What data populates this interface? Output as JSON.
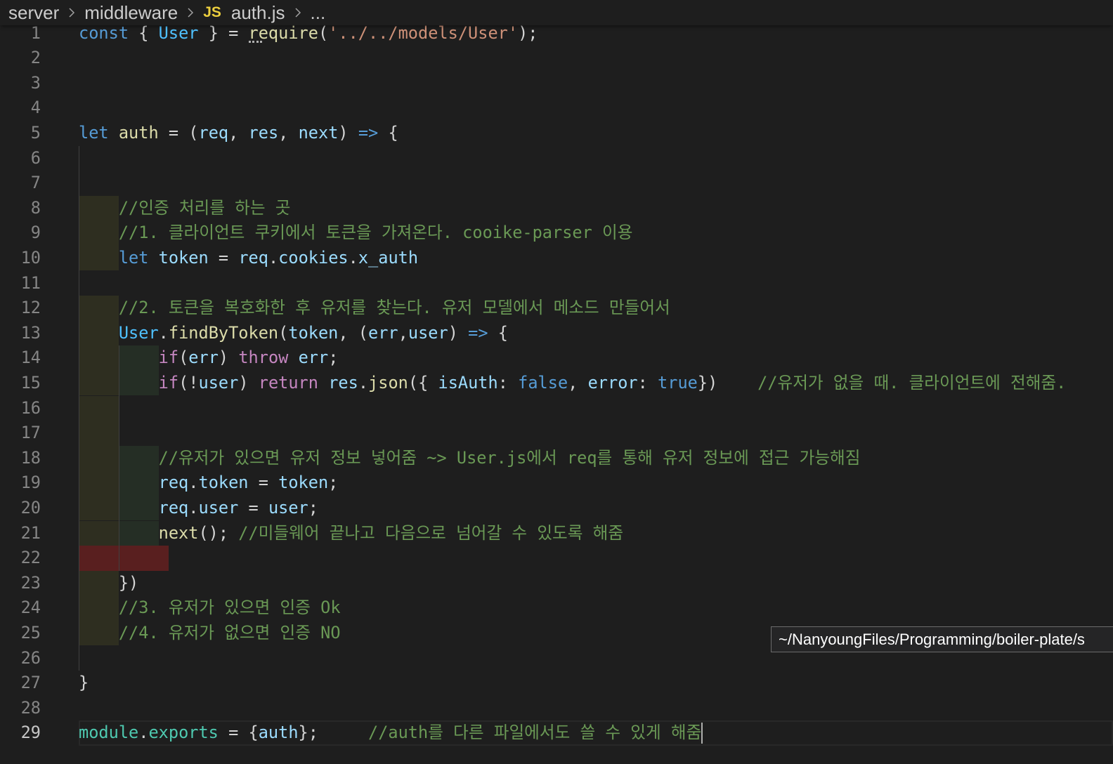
{
  "breadcrumb": {
    "folder_1": "server",
    "folder_2": "middleware",
    "file_icon_label": "JS",
    "file": "auth.js",
    "symbol": "...",
    "separator_icon": "chevron-right-icon"
  },
  "tooltip": {
    "text": "~/NanyoungFiles/Programming/boiler-plate/s"
  },
  "colors": {
    "background": "#1e1e1e",
    "js_icon": "#eccf3e",
    "syntax": {
      "kw": "#569cd6",
      "ctl": "#c586c0",
      "fn": "#dcdcaa",
      "fnh": "#dcdcaa",
      "var": "#9cdcfe",
      "cst": "#4fc1ff",
      "str": "#ce9178",
      "cmt": "#6a9955",
      "p": "#d4d4d4",
      "ty": "#4ec9b0"
    },
    "indent_levels": [
      "#ffff4012",
      "#7fff7f12",
      "#ff7fff12",
      "#4fecec12"
    ],
    "indent_error": "#80202099"
  },
  "editor": {
    "current_line": 29,
    "lines": [
      {
        "n": 1,
        "tokens": [
          {
            "kw": "const"
          },
          {
            "p": " { "
          },
          {
            "cst": "User"
          },
          {
            "p": " } = "
          },
          {
            "fnh": "require"
          },
          {
            "p": "("
          },
          {
            "str": "'../../models/User'"
          },
          {
            "p": ");"
          }
        ]
      },
      {
        "n": 2,
        "tokens": []
      },
      {
        "n": 3,
        "tokens": []
      },
      {
        "n": 4,
        "tokens": []
      },
      {
        "n": 5,
        "tokens": [
          {
            "kw": "let"
          },
          {
            "p": " "
          },
          {
            "fn": "auth"
          },
          {
            "p": " = ("
          },
          {
            "var": "req"
          },
          {
            "p": ", "
          },
          {
            "var": "res"
          },
          {
            "p": ", "
          },
          {
            "var": "next"
          },
          {
            "p": ") "
          },
          {
            "kw": "=>"
          },
          {
            "p": " {"
          }
        ]
      },
      {
        "n": 6,
        "tokens": []
      },
      {
        "n": 7,
        "tokens": []
      },
      {
        "n": 8,
        "tokens": [
          {
            "ws": "    "
          },
          {
            "cmt": "//인증 처리를 하는 곳"
          }
        ]
      },
      {
        "n": 9,
        "tokens": [
          {
            "ws": "    "
          },
          {
            "cmt": "//1. 클라이언트 쿠키에서 토큰을 가져온다. cooike-parser 이용"
          }
        ]
      },
      {
        "n": 10,
        "tokens": [
          {
            "ws": "    "
          },
          {
            "kw": "let"
          },
          {
            "p": " "
          },
          {
            "var": "token"
          },
          {
            "p": " = "
          },
          {
            "var": "req"
          },
          {
            "p": "."
          },
          {
            "var": "cookies"
          },
          {
            "p": "."
          },
          {
            "var": "x_auth"
          }
        ]
      },
      {
        "n": 11,
        "tokens": []
      },
      {
        "n": 12,
        "tokens": [
          {
            "ws": "    "
          },
          {
            "cmt": "//2. 토큰을 복호화한 후 유저를 찾는다. 유저 모델에서 메소드 만들어서"
          }
        ]
      },
      {
        "n": 13,
        "tokens": [
          {
            "ws": "    "
          },
          {
            "cst": "User"
          },
          {
            "p": "."
          },
          {
            "fn": "findByToken"
          },
          {
            "p": "("
          },
          {
            "var": "token"
          },
          {
            "p": ", ("
          },
          {
            "var": "err"
          },
          {
            "p": ","
          },
          {
            "var": "user"
          },
          {
            "p": ") "
          },
          {
            "kw": "=>"
          },
          {
            "p": " {"
          }
        ]
      },
      {
        "n": 14,
        "tokens": [
          {
            "ws": "        "
          },
          {
            "ctl": "if"
          },
          {
            "p": "("
          },
          {
            "var": "err"
          },
          {
            "p": ") "
          },
          {
            "ctl": "throw"
          },
          {
            "p": " "
          },
          {
            "var": "err"
          },
          {
            "p": ";"
          }
        ]
      },
      {
        "n": 15,
        "tokens": [
          {
            "ws": "        "
          },
          {
            "ctl": "if"
          },
          {
            "p": "(!"
          },
          {
            "var": "user"
          },
          {
            "p": ") "
          },
          {
            "ctl": "return"
          },
          {
            "p": " "
          },
          {
            "var": "res"
          },
          {
            "p": "."
          },
          {
            "fn": "json"
          },
          {
            "p": "({ "
          },
          {
            "var": "isAuth"
          },
          {
            "p": ": "
          },
          {
            "kw": "false"
          },
          {
            "p": ", "
          },
          {
            "var": "error"
          },
          {
            "p": ": "
          },
          {
            "kw": "true"
          },
          {
            "p": "})    "
          },
          {
            "cmt": "//유저가 없을 때. 클라이언트에 전해줌."
          }
        ]
      },
      {
        "n": 16,
        "tokens": [
          {
            "ws": "    "
          }
        ]
      },
      {
        "n": 17,
        "tokens": [
          {
            "ws": "    "
          }
        ]
      },
      {
        "n": 18,
        "tokens": [
          {
            "ws": "        "
          },
          {
            "cmt": "//유저가 있으면 유저 정보 넣어줌 ~> User.js에서 req를 통해 유저 정보에 접근 가능해짐"
          }
        ]
      },
      {
        "n": 19,
        "tokens": [
          {
            "ws": "        "
          },
          {
            "var": "req"
          },
          {
            "p": "."
          },
          {
            "var": "token"
          },
          {
            "p": " = "
          },
          {
            "var": "token"
          },
          {
            "p": ";"
          }
        ]
      },
      {
        "n": 20,
        "tokens": [
          {
            "ws": "        "
          },
          {
            "var": "req"
          },
          {
            "p": "."
          },
          {
            "var": "user"
          },
          {
            "p": " = "
          },
          {
            "var": "user"
          },
          {
            "p": ";"
          }
        ]
      },
      {
        "n": 21,
        "tokens": [
          {
            "ws": "        "
          },
          {
            "fn": "next"
          },
          {
            "p": "(); "
          },
          {
            "cmt": "//미들웨어 끝나고 다음으로 넘어갈 수 있도록 해줌"
          }
        ]
      },
      {
        "n": 22,
        "tokens": [
          {
            "ws": "         "
          }
        ]
      },
      {
        "n": 23,
        "tokens": [
          {
            "ws": "    "
          },
          {
            "p": "})"
          }
        ]
      },
      {
        "n": 24,
        "tokens": [
          {
            "ws": "    "
          },
          {
            "cmt": "//3. 유저가 있으면 인증 Ok"
          }
        ]
      },
      {
        "n": 25,
        "tokens": [
          {
            "ws": "    "
          },
          {
            "cmt": "//4. 유저가 없으면 인증 NO"
          }
        ]
      },
      {
        "n": 26,
        "tokens": []
      },
      {
        "n": 27,
        "tokens": [
          {
            "p": "}"
          }
        ]
      },
      {
        "n": 28,
        "tokens": []
      },
      {
        "n": 29,
        "tokens": [
          {
            "ty": "module"
          },
          {
            "p": "."
          },
          {
            "ty": "exports"
          },
          {
            "p": " = {"
          },
          {
            "var": "auth"
          },
          {
            "p": "};     "
          },
          {
            "cmt": "//auth를 다른 파일에서도 쓸 수 있게 해줌"
          }
        ]
      }
    ]
  }
}
